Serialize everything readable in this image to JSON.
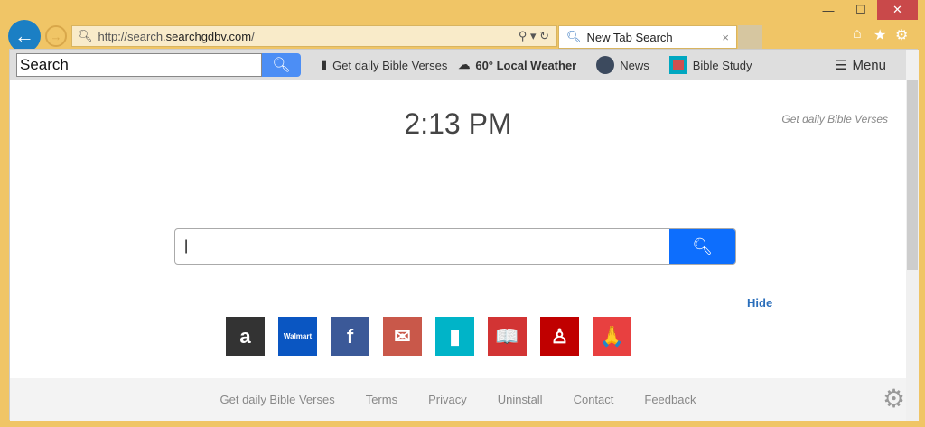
{
  "window": {
    "minimize": "—",
    "maximize": "☐",
    "close": "✕"
  },
  "address": {
    "prefix": "http://search.",
    "domain": "searchgdbv.com",
    "suffix": "/"
  },
  "tab": {
    "title": "New Tab Search",
    "close": "×"
  },
  "toolbar": {
    "search_value": "Search",
    "items": [
      "Get daily Bible Verses",
      "60° Local Weather",
      "News",
      "Bible Study"
    ],
    "menu": "Menu"
  },
  "clock": "2:13 PM",
  "brand_link": "Get daily Bible Verses",
  "hide": "Hide",
  "tiles": [
    {
      "name": "amazon",
      "label": "a",
      "color": "#333333"
    },
    {
      "name": "walmart",
      "label": "Walmart",
      "color": "#0a56c2"
    },
    {
      "name": "facebook",
      "label": "f",
      "color": "#3b5998"
    },
    {
      "name": "mail",
      "label": "✉",
      "color": "#c9584a"
    },
    {
      "name": "bible-book",
      "label": "▮",
      "color": "#00b4c8"
    },
    {
      "name": "open-bible",
      "label": "📖",
      "color": "#d23434"
    },
    {
      "name": "reading",
      "label": "♙",
      "color": "#c00000"
    },
    {
      "name": "prayer",
      "label": "🙏",
      "color": "#e84040"
    }
  ],
  "footer": [
    "Get daily Bible Verses",
    "Terms",
    "Privacy",
    "Uninstall",
    "Contact",
    "Feedback"
  ]
}
